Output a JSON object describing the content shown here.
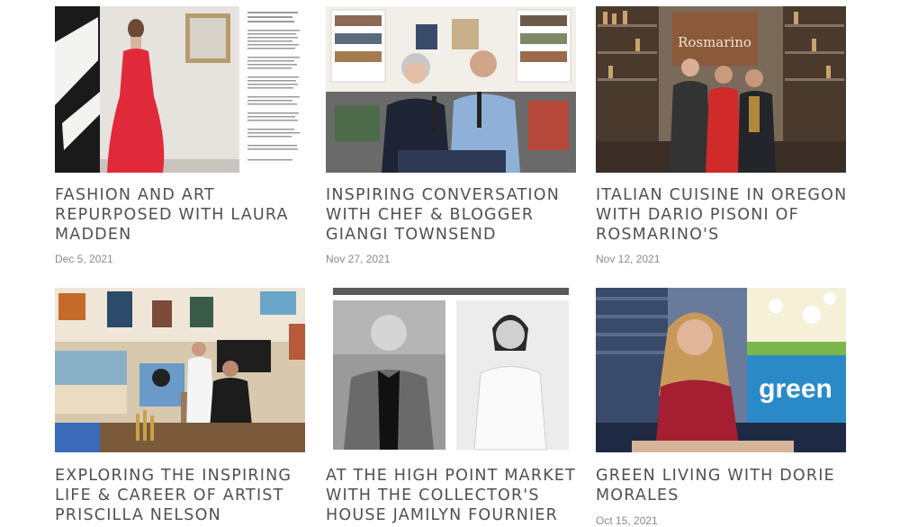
{
  "posts": [
    {
      "title_line1": "FASHION AND ART",
      "title_line2": "REPURPOSED WITH LAURA",
      "title_line3": "MADDEN",
      "date": "Dec 5, 2021",
      "image": "woman-red-gown-photo"
    },
    {
      "title_line1": "INSPIRING CONVERSATION",
      "title_line2": "WITH CHEF & BLOGGER",
      "title_line3": "GIANGI TOWNSEND",
      "date": "Nov 27, 2021",
      "image": "podcast-hosts-photo"
    },
    {
      "title_line1": "ITALIAN CUISINE IN OREGON",
      "title_line2": "WITH DARIO PISONI OF",
      "title_line3": "ROSMARINO'S",
      "date": "Nov 12, 2021",
      "image": "restaurant-men-photo",
      "sign_text": "Rosmarino"
    },
    {
      "title_line1": "EXPLORING THE INSPIRING",
      "title_line2": "LIFE & CAREER OF ARTIST",
      "title_line3": "PRISCILLA NELSON",
      "date": "",
      "image": "artist-studio-photo"
    },
    {
      "title_line1": "AT THE HIGH POINT MARKET",
      "title_line2": "WITH THE COLLECTOR'S",
      "title_line3": "HOUSE JAMILYN FOURNIER",
      "date": "",
      "image": "bw-portraits-photo"
    },
    {
      "title_line1": "GREEN LIVING WITH DORIE",
      "title_line2": "MORALES",
      "title_line3": "",
      "date": "Oct 15, 2021",
      "image": "woman-green-sign-photo",
      "sign_text": "green"
    }
  ],
  "colors": {
    "title": "#505050",
    "date": "#8a8a8a"
  }
}
